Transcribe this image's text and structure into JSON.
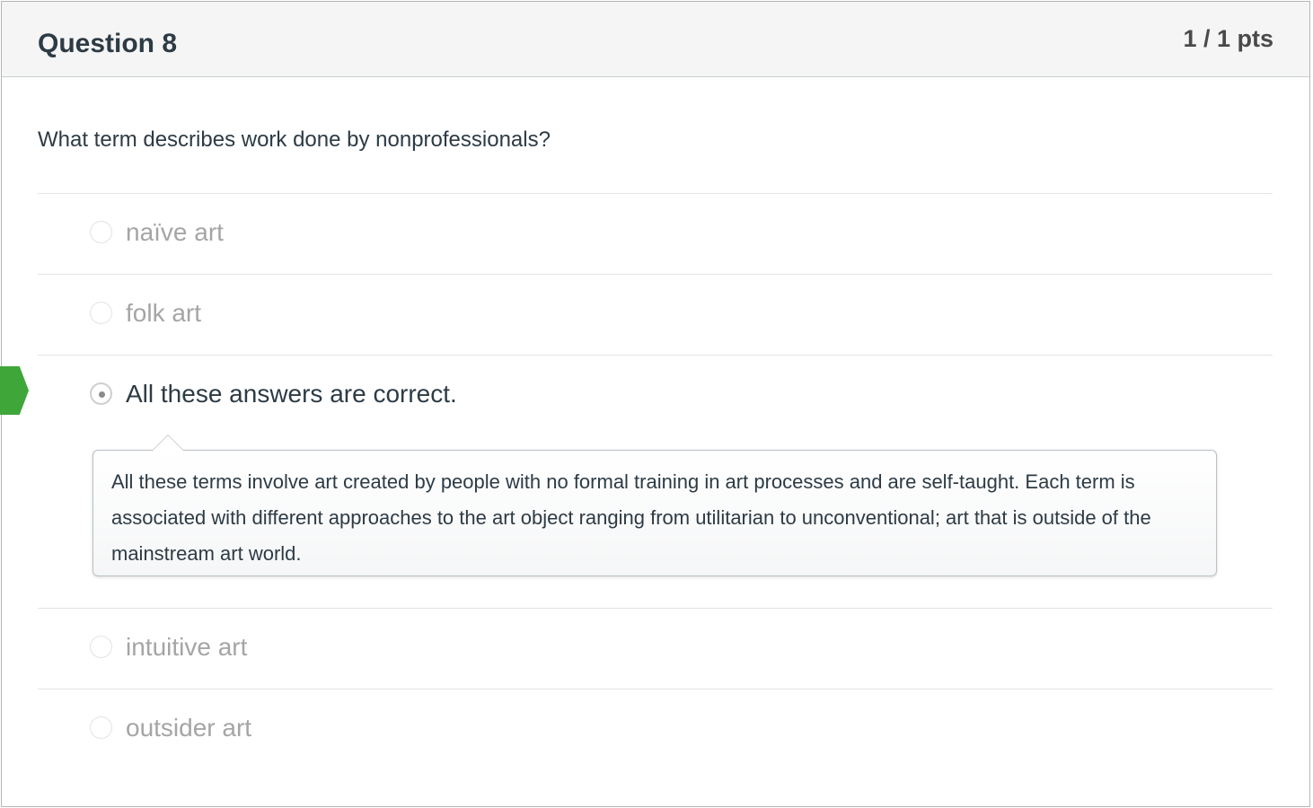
{
  "question": {
    "title": "Question 8",
    "points": "1 / 1 pts",
    "text": "What term describes work done by nonprofessionals?"
  },
  "answers": [
    {
      "label": "naïve art",
      "selected": false
    },
    {
      "label": "folk art",
      "selected": false
    },
    {
      "label": "All these answers are correct.",
      "selected": true
    },
    {
      "label": "intuitive art",
      "selected": false
    },
    {
      "label": "outsider art",
      "selected": false
    }
  ],
  "comment": {
    "text": "All these terms involve art created by people with no formal training in art processes and are self-taught.  Each term is associated with different approaches to the art object ranging from utilitarian to unconventional; art that is outside of the mainstream art world."
  },
  "colors": {
    "correct_flag": "#3fa63a",
    "header_bg": "#f5f5f5"
  },
  "icons": {
    "correct_answer_marker": "correct-answer-flag-icon"
  }
}
